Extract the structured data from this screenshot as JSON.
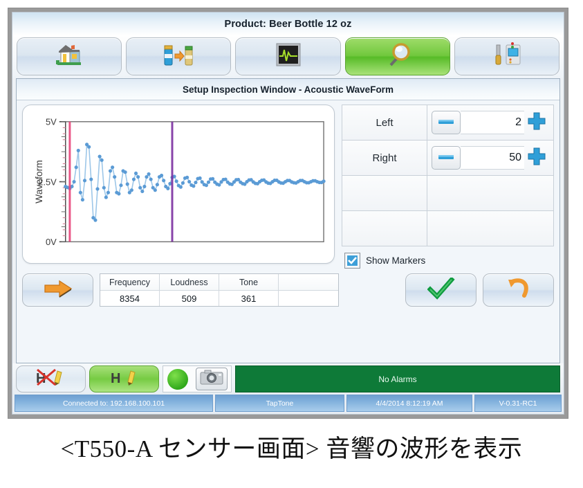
{
  "window": {
    "title": "Product: Beer Bottle 12 oz"
  },
  "toolbar": {
    "buttons": [
      {
        "name": "home",
        "icon": "house-icon",
        "active": false
      },
      {
        "name": "product-change",
        "icon": "bottle-swap-icon",
        "active": false
      },
      {
        "name": "waveform-monitor",
        "icon": "oscilloscope-icon",
        "active": false
      },
      {
        "name": "inspect-setup",
        "icon": "magnifier-icon",
        "active": true
      },
      {
        "name": "diagnostics",
        "icon": "screwdriver-panel-icon",
        "active": false
      }
    ]
  },
  "panel": {
    "header": "Setup Inspection Window - Acoustic WaveForm"
  },
  "controls": {
    "rows": [
      {
        "label": "Left",
        "value": "2"
      },
      {
        "label": "Right",
        "value": "50"
      },
      {
        "label": "",
        "value": ""
      },
      {
        "label": "",
        "value": ""
      }
    ],
    "minus_icon": "minus-icon",
    "plus_icon": "plus-icon",
    "show_markers_label": "Show Markers",
    "show_markers_checked": true
  },
  "actions": {
    "next_icon": "orange-right-arrow-icon",
    "accept_icon": "green-check-icon",
    "undo_icon": "orange-undo-arrow-icon"
  },
  "data_table": {
    "headers": [
      "Frequency",
      "Loudness",
      "Tone",
      ""
    ],
    "values": [
      "8354",
      "509",
      "361",
      ""
    ]
  },
  "bottom_bar": {
    "buttons": [
      {
        "name": "edit-disabled",
        "icon": "h-pencil-crossed-icon",
        "active": false
      },
      {
        "name": "edit-enabled",
        "icon": "h-pencil-icon",
        "active": true
      }
    ],
    "lamp_icon": "green-status-lamp-icon",
    "camera_icon": "camera-icon",
    "alarm_text": "No Alarms",
    "alarm_color": "#0e7a38"
  },
  "status_bar": {
    "connection": "Connected to: 192.168.100.101",
    "mode": "TapTone",
    "timestamp": "4/4/2014 8:12:19 AM",
    "version": "V-0.31-RC1"
  },
  "caption": "<T550-A センサー画面>  音響の波形を表示",
  "chart_data": {
    "type": "line",
    "title": "",
    "xlabel": "",
    "ylabel": "Waveform",
    "ylim": [
      0,
      5
    ],
    "ytick_labels": [
      "5V",
      "2.5V",
      "0V"
    ],
    "ytick_values": [
      5,
      2.5,
      0
    ],
    "grid": false,
    "legend": "none",
    "markers_shown": true,
    "series_color": "#5b9bd5",
    "markers": [
      {
        "name": "left-marker",
        "x_index": 2,
        "color": "#e8447a"
      },
      {
        "name": "right-marker",
        "x_index": 50,
        "color": "#7b2fa0"
      }
    ],
    "description": "Damped acoustic ringdown oscillation about a 2.5V baseline",
    "baseline": 2.5,
    "x": [
      0,
      1,
      2,
      3,
      4,
      5,
      6,
      7,
      8,
      9,
      10,
      11,
      12,
      13,
      14,
      15,
      16,
      17,
      18,
      19,
      20,
      21,
      22,
      23,
      24,
      25,
      26,
      27,
      28,
      29,
      30,
      31,
      32,
      33,
      34,
      35,
      36,
      37,
      38,
      39,
      40,
      41,
      42,
      43,
      44,
      45,
      46,
      47,
      48,
      49,
      50,
      51,
      52,
      53,
      54,
      55,
      56,
      57,
      58,
      59,
      60,
      61,
      62,
      63,
      64,
      65,
      66,
      67,
      68,
      69,
      70,
      71,
      72,
      73,
      74,
      75,
      76,
      77,
      78,
      79,
      80,
      81,
      82,
      83,
      84,
      85,
      86,
      87,
      88,
      89,
      90,
      91,
      92,
      93,
      94,
      95,
      96,
      97,
      98,
      99,
      100,
      101,
      102,
      103,
      104,
      105,
      106,
      107,
      108,
      109,
      110,
      111,
      112,
      113,
      114,
      115,
      116,
      117,
      118,
      119
    ],
    "values": [
      2.3,
      2.26,
      2.22,
      2.3,
      2.5,
      3.1,
      3.8,
      2.05,
      1.75,
      2.55,
      4.05,
      3.95,
      2.6,
      1.0,
      0.9,
      2.2,
      3.55,
      3.4,
      2.25,
      1.85,
      2.05,
      2.95,
      3.1,
      2.7,
      2.05,
      2.0,
      2.35,
      2.95,
      2.9,
      2.4,
      2.05,
      2.15,
      2.6,
      2.85,
      2.7,
      2.25,
      2.1,
      2.3,
      2.7,
      2.82,
      2.6,
      2.25,
      2.15,
      2.38,
      2.7,
      2.76,
      2.55,
      2.3,
      2.22,
      2.42,
      2.68,
      2.72,
      2.52,
      2.34,
      2.28,
      2.45,
      2.65,
      2.68,
      2.5,
      2.36,
      2.32,
      2.47,
      2.63,
      2.65,
      2.49,
      2.38,
      2.35,
      2.48,
      2.61,
      2.62,
      2.48,
      2.4,
      2.37,
      2.49,
      2.59,
      2.6,
      2.48,
      2.41,
      2.39,
      2.49,
      2.58,
      2.59,
      2.48,
      2.42,
      2.4,
      2.5,
      2.57,
      2.58,
      2.49,
      2.43,
      2.42,
      2.5,
      2.56,
      2.57,
      2.49,
      2.44,
      2.43,
      2.5,
      2.56,
      2.56,
      2.49,
      2.45,
      2.44,
      2.5,
      2.55,
      2.55,
      2.49,
      2.46,
      2.45,
      2.5,
      2.55,
      2.55,
      2.5,
      2.46,
      2.46,
      2.5,
      2.54,
      2.54,
      2.5,
      2.47,
      2.47,
      2.52
    ]
  }
}
